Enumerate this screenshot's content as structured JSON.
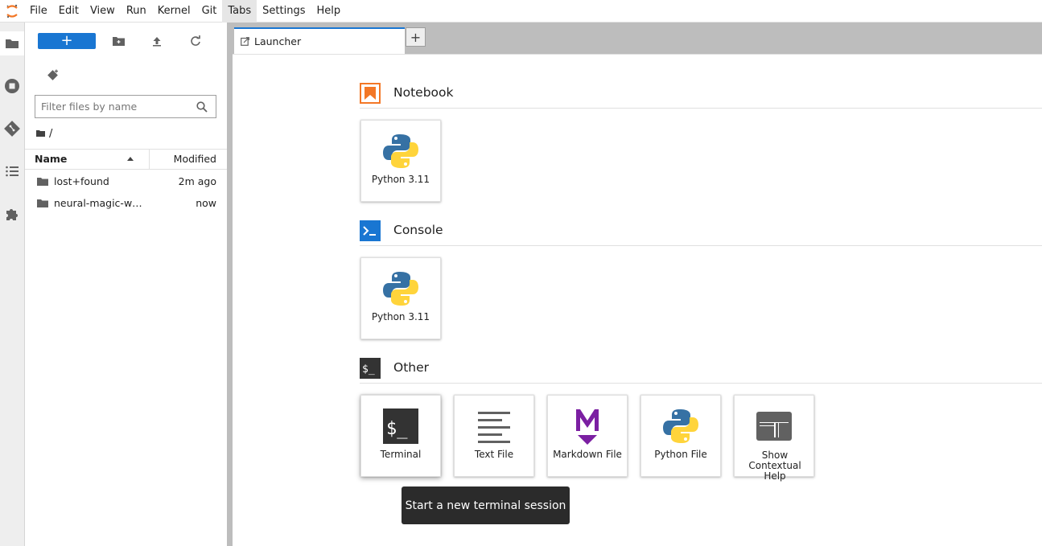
{
  "menubar": {
    "items": [
      "File",
      "Edit",
      "View",
      "Run",
      "Kernel",
      "Git",
      "Tabs",
      "Settings",
      "Help"
    ],
    "active_index": 6
  },
  "activity_bar": {
    "icons": [
      "folder-icon",
      "running-icon",
      "git-icon",
      "toc-icon",
      "extension-icon"
    ],
    "selected": "folder-icon"
  },
  "file_browser": {
    "new_button_label": "+",
    "filter_placeholder": "Filter files by name",
    "breadcrumb_path": "/",
    "columns": {
      "name": "Name",
      "modified": "Modified"
    },
    "rows": [
      {
        "name": "lost+found",
        "modified": "2m ago"
      },
      {
        "name": "neural-magic-w…",
        "modified": "now"
      }
    ]
  },
  "tabs": {
    "items": [
      {
        "label": "Launcher"
      }
    ],
    "add_label": "+"
  },
  "launcher": {
    "sections": [
      {
        "title": "Notebook",
        "cards": [
          {
            "label": "Python 3.11",
            "icon": "python-icon"
          }
        ]
      },
      {
        "title": "Console",
        "cards": [
          {
            "label": "Python 3.11",
            "icon": "python-icon"
          }
        ]
      },
      {
        "title": "Other",
        "cards": [
          {
            "label": "Terminal",
            "icon": "terminal-icon"
          },
          {
            "label": "Text File",
            "icon": "text-file-icon"
          },
          {
            "label": "Markdown File",
            "icon": "markdown-icon"
          },
          {
            "label": "Python File",
            "icon": "python-icon"
          },
          {
            "label": "Show Contextual Help",
            "icon": "contextual-help-icon"
          }
        ]
      }
    ],
    "tooltip": "Start a new terminal session"
  },
  "colors": {
    "accent": "#1976d2",
    "notebook_orange": "#f37726",
    "console_blue": "#1976d2",
    "markdown_purple": "#7b1fa2",
    "terminal_dark": "#333333"
  }
}
